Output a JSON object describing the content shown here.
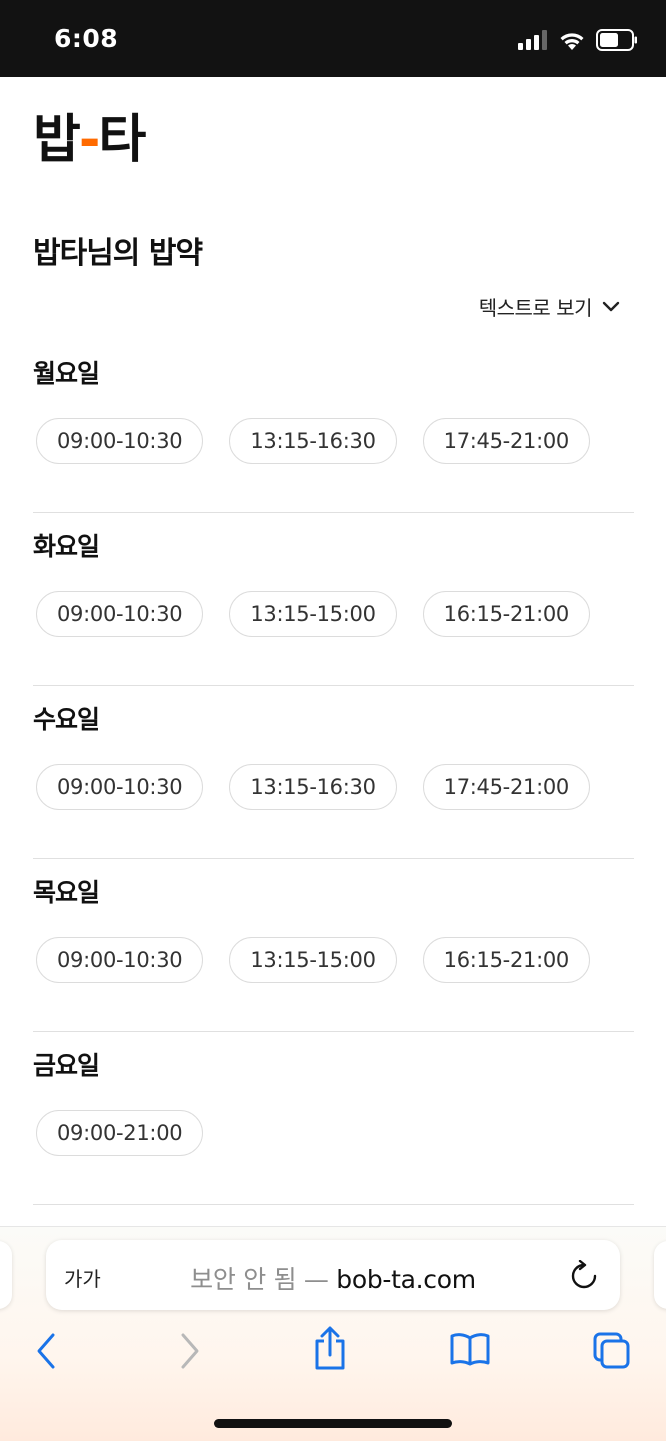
{
  "status_bar": {
    "time": "6:08"
  },
  "logo": {
    "part1": "밥",
    "dash": "-",
    "part2": "타"
  },
  "page_title": "밥타님의 밥약",
  "text_view_label": "텍스트로 보기",
  "days": [
    {
      "label": "월요일",
      "slots": [
        "09:00-10:30",
        "13:15-16:30",
        "17:45-21:00"
      ]
    },
    {
      "label": "화요일",
      "slots": [
        "09:00-10:30",
        "13:15-15:00",
        "16:15-21:00"
      ]
    },
    {
      "label": "수요일",
      "slots": [
        "09:00-10:30",
        "13:15-16:30",
        "17:45-21:00"
      ]
    },
    {
      "label": "목요일",
      "slots": [
        "09:00-10:30",
        "13:15-15:00",
        "16:15-21:00"
      ]
    },
    {
      "label": "금요일",
      "slots": [
        "09:00-21:00"
      ]
    }
  ],
  "browser": {
    "text_size_button": "가가",
    "insecure_label": "보안 안 됨 —",
    "domain": "bob-ta.com"
  },
  "colors": {
    "accent": "#ff6a00",
    "link_blue": "#1a73e8"
  },
  "icons": [
    "signal-icon",
    "wifi-icon",
    "battery-icon",
    "chevron-down-icon",
    "reload-icon",
    "back-icon",
    "forward-icon",
    "share-icon",
    "bookmarks-icon",
    "tabs-icon"
  ]
}
